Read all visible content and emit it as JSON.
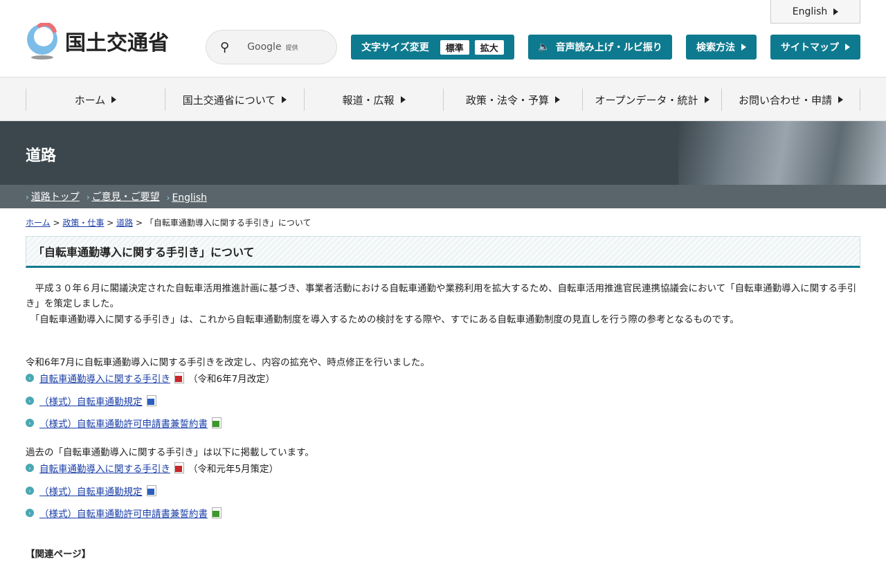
{
  "header": {
    "logo_text": "国土交通省",
    "search_label": "Google",
    "search_provider": "提供",
    "english": "English",
    "font_size": {
      "label": "文字サイズ変更",
      "standard": "標準",
      "large": "拡大"
    },
    "speech": "音声読み上げ・ルビ振り",
    "search_method": "検索方法",
    "sitemap": "サイトマップ"
  },
  "nav": [
    "ホーム",
    "国土交通省について",
    "報道・広報",
    "政策・法令・予算",
    "オープンデータ・統計",
    "お問い合わせ・申請"
  ],
  "banner": {
    "title": "道路"
  },
  "subnav": [
    "道路トップ",
    "ご意見・ご要望",
    "English"
  ],
  "breadcrumb": {
    "items": [
      "ホーム",
      "政策・仕事",
      "道路"
    ],
    "current": "「自転車通勤導入に関する手引き」について",
    "sep": ">"
  },
  "page_title": "「自転車通勤導入に関する手引き」について",
  "intro": [
    "　平成３０年６月に閣議決定された自転車活用推進計画に基づき、事業者活動における自転車通勤や業務利用を拡大するため、自転車活用推進官民連携協議会において「自転車通勤導入に関する手引き」を策定しました。",
    "　「自転車通勤導入に関する手引き」は、これから自転車通勤制度を導入するための検討をする際や、すでにある自転車通勤制度の見直しを行う際の参考となるものです。"
  ],
  "current": {
    "lead": "令和6年7月に自転車通勤導入に関する手引きを改定し、内容の拡充や、時点修正を行いました。",
    "links": [
      {
        "label": "自転車通勤導入に関する手引き",
        "type": "pdf",
        "note": "（令和6年7月改定）"
      },
      {
        "label": "（様式）自転車通勤規定",
        "type": "word",
        "note": ""
      },
      {
        "label": "（様式）自転車通勤許可申請書兼誓約書",
        "type": "excel",
        "note": ""
      }
    ]
  },
  "past": {
    "lead": "過去の「自転車通勤導入に関する手引き」は以下に掲載しています。",
    "links": [
      {
        "label": "自転車通勤導入に関する手引き",
        "type": "pdf",
        "note": "（令和元年5月策定）"
      },
      {
        "label": "（様式）自転車通勤規定",
        "type": "word",
        "note": ""
      },
      {
        "label": "（様式）自転車通勤許可申請書兼誓約書",
        "type": "excel",
        "note": ""
      }
    ]
  },
  "related": "【関連ページ】"
}
